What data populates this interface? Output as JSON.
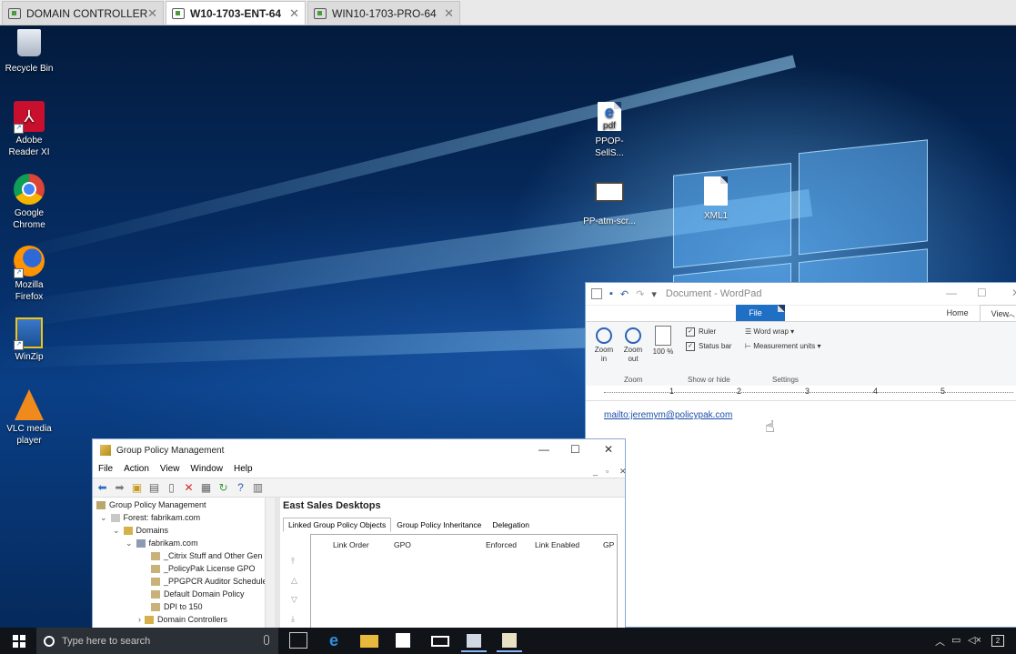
{
  "vm_tabs": [
    {
      "label": "DOMAIN CONTROLLER",
      "active": false
    },
    {
      "label": "W10-1703-ENT-64",
      "active": true
    },
    {
      "label": "WIN10-1703-PRO-64",
      "active": false
    }
  ],
  "tab_close_glyph": "✕",
  "desktop_icons": [
    {
      "label": "Recycle Bin",
      "icon": "recycle-bin-icon"
    },
    {
      "label": "Adobe Reader XI",
      "icon": "adobe-reader-icon"
    },
    {
      "label": "Google Chrome",
      "icon": "chrome-icon"
    },
    {
      "label": "Mozilla Firefox",
      "icon": "firefox-icon"
    },
    {
      "label": "WinZip",
      "icon": "winzip-icon"
    },
    {
      "label": "VLC media player",
      "icon": "vlc-icon"
    },
    {
      "label": "PPOP-SellS...",
      "icon": "pdf-file-icon"
    },
    {
      "label": "PP-atm-scr...",
      "icon": "screenshot-file-icon"
    },
    {
      "label": "XML1",
      "icon": "file-icon"
    }
  ],
  "wordpad": {
    "title": "Document - WordPad",
    "tabs": [
      "File",
      "Home",
      "View"
    ],
    "zoom_in": "Zoom in",
    "zoom_out": "Zoom out",
    "hundred_percent": "100 %",
    "zoom_group": "Zoom",
    "ruler_label": "Ruler",
    "status_bar_label": "Status bar",
    "show_hide_group": "Show or hide",
    "word_wrap": "Word wrap",
    "measurement_units": "Measurement units",
    "settings_group": "Settings",
    "ruler_numbers": [
      "1",
      "2",
      "3",
      "4",
      "5"
    ],
    "content_link": "mailto:jeremym@policypak.com"
  },
  "gpm": {
    "title": "Group Policy Management",
    "menu": [
      "File",
      "Action",
      "View",
      "Window",
      "Help"
    ],
    "tree": [
      "Group Policy Management",
      "Forest: fabrikam.com",
      "Domains",
      "fabrikam.com",
      "_Citrix Stuff and Other Gen",
      "_PolicyPak License GPO",
      "_PPGPCR Auditor Schedule",
      "Default Domain Policy",
      "DPI to 150",
      "Domain Controllers"
    ],
    "heading": "East Sales Desktops",
    "tabs": [
      "Linked Group Policy Objects",
      "Group Policy Inheritance",
      "Delegation"
    ],
    "columns": [
      "Link Order",
      "GPO",
      "Enforced",
      "Link Enabled",
      "GP"
    ]
  },
  "taskbar": {
    "search_placeholder": "Type here to search"
  }
}
